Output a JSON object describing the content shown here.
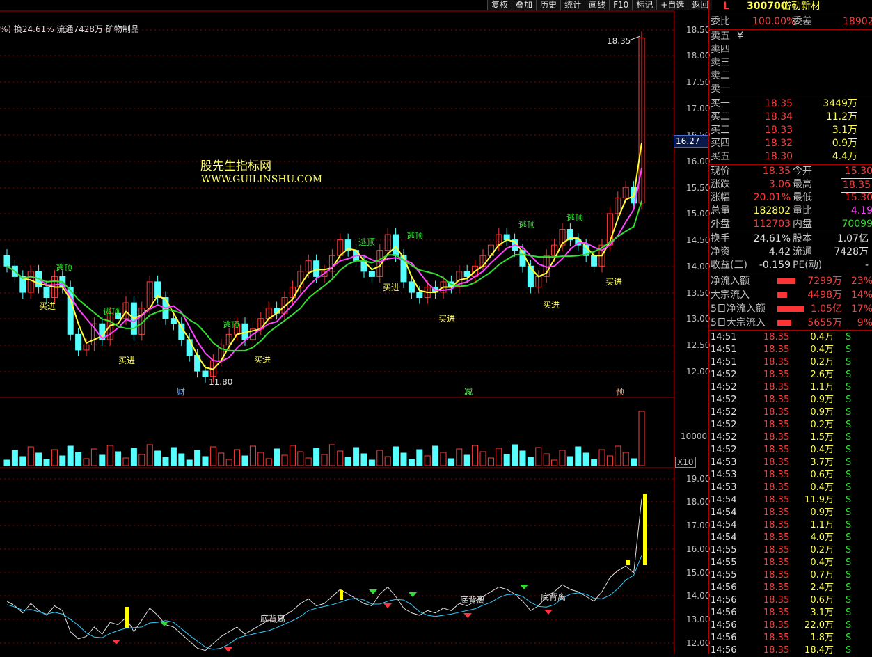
{
  "toolbar": {
    "buttons": [
      "复权",
      "叠加",
      "历史",
      "统计",
      "画线",
      "F10",
      "标记",
      "+自选",
      "返回"
    ]
  },
  "info": "%) 换24.61% 流通7428万 矿物制品",
  "watermark": {
    "line1": "股先生指标网",
    "line2": "WWW.GUILINSHU.COM"
  },
  "price_axis": {
    "main": [
      "18.50",
      "18.00",
      "17.50",
      "17.00",
      "16.50",
      "16.00",
      "15.50",
      "15.00",
      "14.50",
      "14.00",
      "13.50",
      "13.00",
      "12.50",
      "12.00"
    ],
    "current": "16.27",
    "volume": "10000",
    "volume_unit": "X10",
    "indicator": [
      "19.00",
      "18.00",
      "17.00",
      "16.00",
      "15.00",
      "14.00",
      "13.00",
      "12.00"
    ]
  },
  "annotations": {
    "high_label": "18.35",
    "low_label": "11.80",
    "top_signal": "逃顶",
    "buy_signal": "买进",
    "divergence": "底背离",
    "events": [
      "财",
      "减",
      "预"
    ]
  },
  "stock": {
    "market": "L",
    "code": "300700",
    "name": "岱勒新材"
  },
  "order_summary": {
    "weibi_label": "委比",
    "weibi": "100.00%",
    "weicha_label": "委差",
    "weicha": "18902"
  },
  "asks": [
    {
      "label": "卖五",
      "price": "¥",
      "vol": ""
    },
    {
      "label": "卖四",
      "price": "",
      "vol": ""
    },
    {
      "label": "卖三",
      "price": "",
      "vol": ""
    },
    {
      "label": "卖二",
      "price": "",
      "vol": ""
    },
    {
      "label": "卖一",
      "price": "",
      "vol": ""
    }
  ],
  "bids": [
    {
      "label": "买一",
      "price": "18.35",
      "vol": "3449万"
    },
    {
      "label": "买二",
      "price": "18.34",
      "vol": "11.2万"
    },
    {
      "label": "买三",
      "price": "18.33",
      "vol": "3.1万"
    },
    {
      "label": "买四",
      "price": "18.32",
      "vol": "0.9万"
    },
    {
      "label": "买五",
      "price": "18.30",
      "vol": "4.4万"
    }
  ],
  "quote": [
    {
      "l1": "现价",
      "v1": "18.35",
      "l2": "今开",
      "v2": "15.30"
    },
    {
      "l1": "涨跌",
      "v1": "3.06",
      "l2": "最高",
      "v2": "18.35"
    },
    {
      "l1": "涨幅",
      "v1": "20.01%",
      "l2": "最低",
      "v2": "15.30"
    },
    {
      "l1": "总量",
      "v1": "182802",
      "l2": "量比",
      "v2": "4.19"
    },
    {
      "l1": "外盘",
      "v1": "112703",
      "l2": "内盘",
      "v2": "70099"
    }
  ],
  "fundamentals": [
    {
      "l1": "换手",
      "v1": "24.61%",
      "l2": "股本",
      "v2": "1.07亿"
    },
    {
      "l1": "净资",
      "v1": "4.42",
      "l2": "流通",
      "v2": "7428万"
    },
    {
      "l1": "收益(三)",
      "v1": "-0.159",
      "l2": "PE(动)",
      "v2": "-"
    }
  ],
  "flows": [
    {
      "label": "净流入额",
      "value": "7299万",
      "pct": "23%"
    },
    {
      "label": "大宗流入",
      "value": "4498万",
      "pct": "14%"
    },
    {
      "label": "5日净流入额",
      "value": "1.05亿",
      "pct": "17%"
    },
    {
      "label": "5日大宗流入",
      "value": "5655万",
      "pct": "9%"
    }
  ],
  "ticks": [
    {
      "time": "14:51",
      "price": "18.35",
      "vol": "0.4万",
      "dir": "S"
    },
    {
      "time": "14:51",
      "price": "18.35",
      "vol": "0.4万",
      "dir": "S"
    },
    {
      "time": "14:51",
      "price": "18.35",
      "vol": "0.2万",
      "dir": "S"
    },
    {
      "time": "14:52",
      "price": "18.35",
      "vol": "2.6万",
      "dir": "S"
    },
    {
      "time": "14:52",
      "price": "18.35",
      "vol": "1.1万",
      "dir": "S"
    },
    {
      "time": "14:52",
      "price": "18.35",
      "vol": "0.9万",
      "dir": "S"
    },
    {
      "time": "14:52",
      "price": "18.35",
      "vol": "0.9万",
      "dir": "S"
    },
    {
      "time": "14:52",
      "price": "18.35",
      "vol": "0.2万",
      "dir": "S"
    },
    {
      "time": "14:52",
      "price": "18.35",
      "vol": "1.5万",
      "dir": "S"
    },
    {
      "time": "14:52",
      "price": "18.35",
      "vol": "0.4万",
      "dir": "S"
    },
    {
      "time": "14:53",
      "price": "18.35",
      "vol": "3.7万",
      "dir": "S"
    },
    {
      "time": "14:53",
      "price": "18.35",
      "vol": "0.6万",
      "dir": "S"
    },
    {
      "time": "14:53",
      "price": "18.35",
      "vol": "0.4万",
      "dir": "S"
    },
    {
      "time": "14:54",
      "price": "18.35",
      "vol": "11.9万",
      "dir": "S"
    },
    {
      "time": "14:54",
      "price": "18.35",
      "vol": "0.9万",
      "dir": "S"
    },
    {
      "time": "14:54",
      "price": "18.35",
      "vol": "1.1万",
      "dir": "S"
    },
    {
      "time": "14:54",
      "price": "18.35",
      "vol": "4.0万",
      "dir": "S"
    },
    {
      "time": "14:55",
      "price": "18.35",
      "vol": "0.2万",
      "dir": "S"
    },
    {
      "time": "14:55",
      "price": "18.35",
      "vol": "0.4万",
      "dir": "S"
    },
    {
      "time": "14:55",
      "price": "18.35",
      "vol": "0.7万",
      "dir": "S"
    },
    {
      "time": "14:56",
      "price": "18.35",
      "vol": "2.4万",
      "dir": "S"
    },
    {
      "time": "14:56",
      "price": "18.35",
      "vol": "0.6万",
      "dir": "S"
    },
    {
      "time": "14:56",
      "price": "18.35",
      "vol": "3.1万",
      "dir": "S"
    },
    {
      "time": "14:56",
      "price": "18.35",
      "vol": "22.0万",
      "dir": "S"
    },
    {
      "time": "14:56",
      "price": "18.35",
      "vol": "1.8万",
      "dir": "S"
    },
    {
      "time": "14:56",
      "price": "18.35",
      "vol": "18.4万",
      "dir": "S"
    }
  ],
  "colors": {
    "up": "#ff3b3b",
    "down": "#55ffff",
    "ma5": "#ffff33",
    "ma10": "#ff44ff",
    "ma20": "#33dd33",
    "grid": "#8b0000"
  }
}
